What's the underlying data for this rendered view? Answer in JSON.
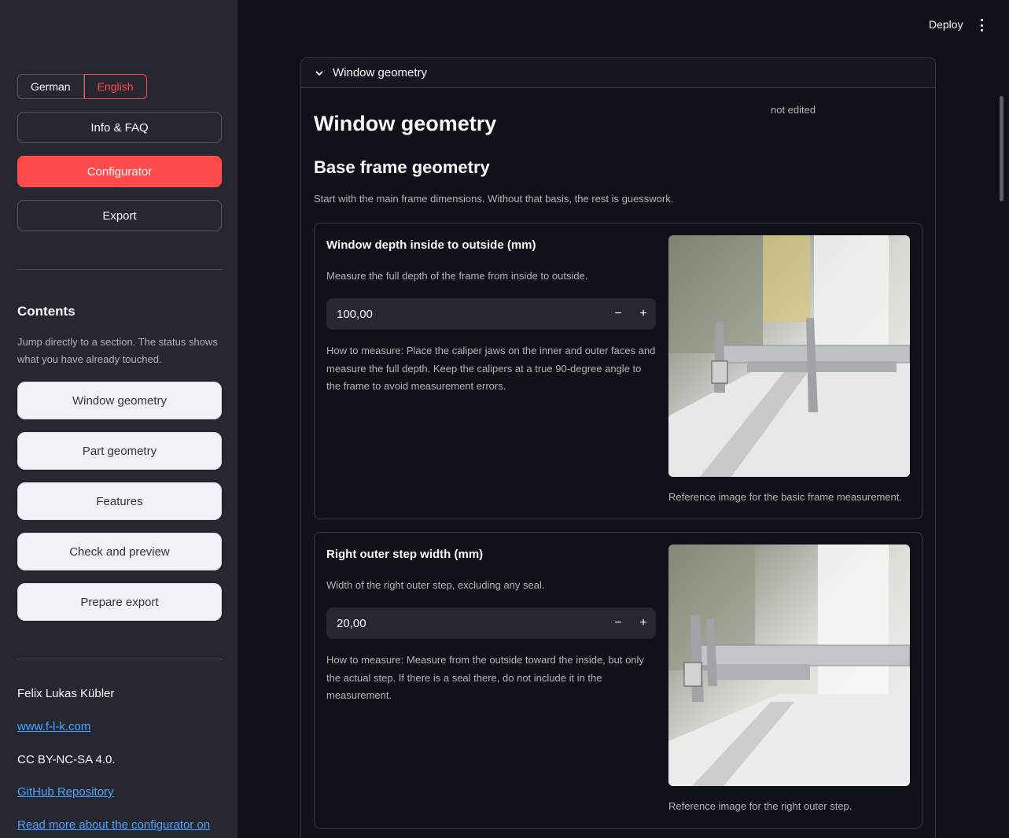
{
  "sidebar": {
    "language": {
      "german": "German",
      "english": "English"
    },
    "nav": {
      "info": "Info & FAQ",
      "configurator": "Configurator",
      "export": "Export"
    },
    "contents_title": "Contents",
    "contents_desc": "Jump directly to a section. The status shows what you have already touched.",
    "toc": [
      "Window geometry",
      "Part geometry",
      "Features",
      "Check and preview",
      "Prepare export"
    ],
    "author": "Felix Lukas Kübler",
    "website": "www.f-l-k.com",
    "license": "CC BY-NC-SA 4.0.",
    "github": "GitHub Repository",
    "read_more": "Read more about the configurator on"
  },
  "header": {
    "deploy": "Deploy",
    "menu_icon": "kebab-menu-icon"
  },
  "main": {
    "expander_title": "Window geometry",
    "status": "not edited",
    "title": "Window geometry",
    "subtitle": "Base frame geometry",
    "intro": "Start with the main frame dimensions. Without that basis, the rest is guesswork.",
    "cards": [
      {
        "title": "Window depth inside to outside (mm)",
        "desc": "Measure the full depth of the frame from inside to outside.",
        "value": "100,00",
        "help": "How to measure: Place the caliper jaws on the inner and outer faces and measure the full depth. Keep the calipers at a true 90-degree angle to the frame to avoid measurement errors.",
        "caption": "Reference image for the basic frame measurement."
      },
      {
        "title": "Right outer step width (mm)",
        "desc": "Width of the right outer step, excluding any seal.",
        "value": "20,00",
        "help": "How to measure: Measure from the outside toward the inside, but only the actual step. If there is a seal there, do not include it in the measurement.",
        "caption": "Reference image for the right outer step."
      }
    ],
    "minus": "−",
    "plus": "+"
  }
}
